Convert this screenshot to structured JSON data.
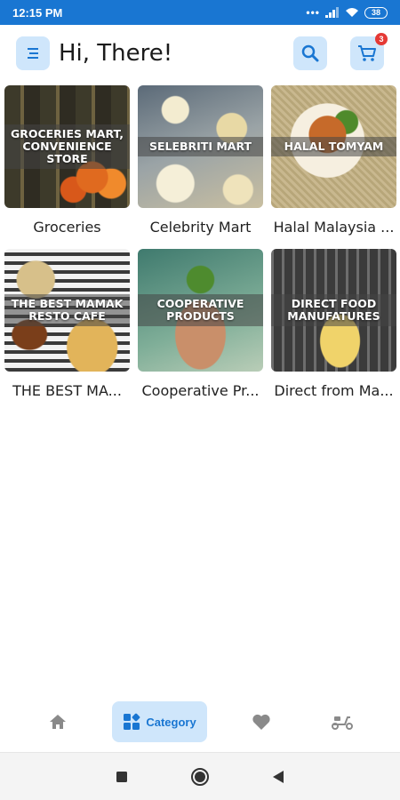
{
  "status_bar": {
    "time": "12:15 PM",
    "battery": "38"
  },
  "header": {
    "title": "Hi, There!",
    "cart_count": "3"
  },
  "categories": [
    {
      "label": "Groceries",
      "overlay": "GROCERIES MART, CONVENIENCE STORE"
    },
    {
      "label": "Celebrity Mart",
      "overlay": "SELEBRITI MART"
    },
    {
      "label": "Halal Malaysia ...",
      "overlay": "HALAL TOMYAM"
    },
    {
      "label": "THE BEST MA...",
      "overlay": "THE BEST MAMAK RESTO CAFE"
    },
    {
      "label": "Cooperative Pr...",
      "overlay": "COOPERATIVE PRODUCTS"
    },
    {
      "label": "Direct from Ma...",
      "overlay": "DIRECT FOOD MANUFATURES"
    }
  ],
  "bottom_nav": {
    "active_label": "Category"
  },
  "colors": {
    "accent": "#1976d2",
    "accent_light": "#cfe6fb",
    "badge": "#e53935"
  }
}
